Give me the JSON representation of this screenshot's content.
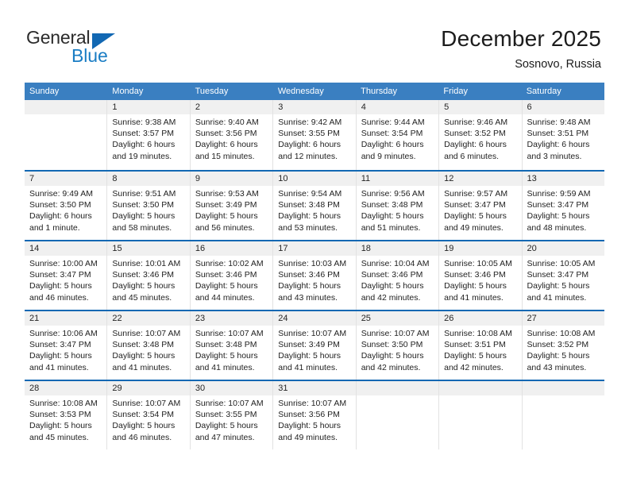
{
  "brand": {
    "name_top": "General",
    "name_bottom": "Blue",
    "accent_color": "#1268b3",
    "logo_blue": "#1a7dc4"
  },
  "header": {
    "title": "December 2025",
    "subtitle": "Sosnovo, Russia"
  },
  "theme": {
    "weekday_header_bg": "#3a7fc1",
    "week_divider": "#1268b3",
    "date_band_bg": "#f0f0f0",
    "cell_border": "#e2e2e2"
  },
  "weekdays": [
    "Sunday",
    "Monday",
    "Tuesday",
    "Wednesday",
    "Thursday",
    "Friday",
    "Saturday"
  ],
  "weeks": [
    [
      {
        "date": ""
      },
      {
        "date": "1",
        "sunrise": "Sunrise: 9:38 AM",
        "sunset": "Sunset: 3:57 PM",
        "daylight_1": "Daylight: 6 hours",
        "daylight_2": "and 19 minutes."
      },
      {
        "date": "2",
        "sunrise": "Sunrise: 9:40 AM",
        "sunset": "Sunset: 3:56 PM",
        "daylight_1": "Daylight: 6 hours",
        "daylight_2": "and 15 minutes."
      },
      {
        "date": "3",
        "sunrise": "Sunrise: 9:42 AM",
        "sunset": "Sunset: 3:55 PM",
        "daylight_1": "Daylight: 6 hours",
        "daylight_2": "and 12 minutes."
      },
      {
        "date": "4",
        "sunrise": "Sunrise: 9:44 AM",
        "sunset": "Sunset: 3:54 PM",
        "daylight_1": "Daylight: 6 hours",
        "daylight_2": "and 9 minutes."
      },
      {
        "date": "5",
        "sunrise": "Sunrise: 9:46 AM",
        "sunset": "Sunset: 3:52 PM",
        "daylight_1": "Daylight: 6 hours",
        "daylight_2": "and 6 minutes."
      },
      {
        "date": "6",
        "sunrise": "Sunrise: 9:48 AM",
        "sunset": "Sunset: 3:51 PM",
        "daylight_1": "Daylight: 6 hours",
        "daylight_2": "and 3 minutes."
      }
    ],
    [
      {
        "date": "7",
        "sunrise": "Sunrise: 9:49 AM",
        "sunset": "Sunset: 3:50 PM",
        "daylight_1": "Daylight: 6 hours",
        "daylight_2": "and 1 minute."
      },
      {
        "date": "8",
        "sunrise": "Sunrise: 9:51 AM",
        "sunset": "Sunset: 3:50 PM",
        "daylight_1": "Daylight: 5 hours",
        "daylight_2": "and 58 minutes."
      },
      {
        "date": "9",
        "sunrise": "Sunrise: 9:53 AM",
        "sunset": "Sunset: 3:49 PM",
        "daylight_1": "Daylight: 5 hours",
        "daylight_2": "and 56 minutes."
      },
      {
        "date": "10",
        "sunrise": "Sunrise: 9:54 AM",
        "sunset": "Sunset: 3:48 PM",
        "daylight_1": "Daylight: 5 hours",
        "daylight_2": "and 53 minutes."
      },
      {
        "date": "11",
        "sunrise": "Sunrise: 9:56 AM",
        "sunset": "Sunset: 3:48 PM",
        "daylight_1": "Daylight: 5 hours",
        "daylight_2": "and 51 minutes."
      },
      {
        "date": "12",
        "sunrise": "Sunrise: 9:57 AM",
        "sunset": "Sunset: 3:47 PM",
        "daylight_1": "Daylight: 5 hours",
        "daylight_2": "and 49 minutes."
      },
      {
        "date": "13",
        "sunrise": "Sunrise: 9:59 AM",
        "sunset": "Sunset: 3:47 PM",
        "daylight_1": "Daylight: 5 hours",
        "daylight_2": "and 48 minutes."
      }
    ],
    [
      {
        "date": "14",
        "sunrise": "Sunrise: 10:00 AM",
        "sunset": "Sunset: 3:47 PM",
        "daylight_1": "Daylight: 5 hours",
        "daylight_2": "and 46 minutes."
      },
      {
        "date": "15",
        "sunrise": "Sunrise: 10:01 AM",
        "sunset": "Sunset: 3:46 PM",
        "daylight_1": "Daylight: 5 hours",
        "daylight_2": "and 45 minutes."
      },
      {
        "date": "16",
        "sunrise": "Sunrise: 10:02 AM",
        "sunset": "Sunset: 3:46 PM",
        "daylight_1": "Daylight: 5 hours",
        "daylight_2": "and 44 minutes."
      },
      {
        "date": "17",
        "sunrise": "Sunrise: 10:03 AM",
        "sunset": "Sunset: 3:46 PM",
        "daylight_1": "Daylight: 5 hours",
        "daylight_2": "and 43 minutes."
      },
      {
        "date": "18",
        "sunrise": "Sunrise: 10:04 AM",
        "sunset": "Sunset: 3:46 PM",
        "daylight_1": "Daylight: 5 hours",
        "daylight_2": "and 42 minutes."
      },
      {
        "date": "19",
        "sunrise": "Sunrise: 10:05 AM",
        "sunset": "Sunset: 3:46 PM",
        "daylight_1": "Daylight: 5 hours",
        "daylight_2": "and 41 minutes."
      },
      {
        "date": "20",
        "sunrise": "Sunrise: 10:05 AM",
        "sunset": "Sunset: 3:47 PM",
        "daylight_1": "Daylight: 5 hours",
        "daylight_2": "and 41 minutes."
      }
    ],
    [
      {
        "date": "21",
        "sunrise": "Sunrise: 10:06 AM",
        "sunset": "Sunset: 3:47 PM",
        "daylight_1": "Daylight: 5 hours",
        "daylight_2": "and 41 minutes."
      },
      {
        "date": "22",
        "sunrise": "Sunrise: 10:07 AM",
        "sunset": "Sunset: 3:48 PM",
        "daylight_1": "Daylight: 5 hours",
        "daylight_2": "and 41 minutes."
      },
      {
        "date": "23",
        "sunrise": "Sunrise: 10:07 AM",
        "sunset": "Sunset: 3:48 PM",
        "daylight_1": "Daylight: 5 hours",
        "daylight_2": "and 41 minutes."
      },
      {
        "date": "24",
        "sunrise": "Sunrise: 10:07 AM",
        "sunset": "Sunset: 3:49 PM",
        "daylight_1": "Daylight: 5 hours",
        "daylight_2": "and 41 minutes."
      },
      {
        "date": "25",
        "sunrise": "Sunrise: 10:07 AM",
        "sunset": "Sunset: 3:50 PM",
        "daylight_1": "Daylight: 5 hours",
        "daylight_2": "and 42 minutes."
      },
      {
        "date": "26",
        "sunrise": "Sunrise: 10:08 AM",
        "sunset": "Sunset: 3:51 PM",
        "daylight_1": "Daylight: 5 hours",
        "daylight_2": "and 42 minutes."
      },
      {
        "date": "27",
        "sunrise": "Sunrise: 10:08 AM",
        "sunset": "Sunset: 3:52 PM",
        "daylight_1": "Daylight: 5 hours",
        "daylight_2": "and 43 minutes."
      }
    ],
    [
      {
        "date": "28",
        "sunrise": "Sunrise: 10:08 AM",
        "sunset": "Sunset: 3:53 PM",
        "daylight_1": "Daylight: 5 hours",
        "daylight_2": "and 45 minutes."
      },
      {
        "date": "29",
        "sunrise": "Sunrise: 10:07 AM",
        "sunset": "Sunset: 3:54 PM",
        "daylight_1": "Daylight: 5 hours",
        "daylight_2": "and 46 minutes."
      },
      {
        "date": "30",
        "sunrise": "Sunrise: 10:07 AM",
        "sunset": "Sunset: 3:55 PM",
        "daylight_1": "Daylight: 5 hours",
        "daylight_2": "and 47 minutes."
      },
      {
        "date": "31",
        "sunrise": "Sunrise: 10:07 AM",
        "sunset": "Sunset: 3:56 PM",
        "daylight_1": "Daylight: 5 hours",
        "daylight_2": "and 49 minutes."
      },
      {
        "date": ""
      },
      {
        "date": ""
      },
      {
        "date": ""
      }
    ]
  ]
}
